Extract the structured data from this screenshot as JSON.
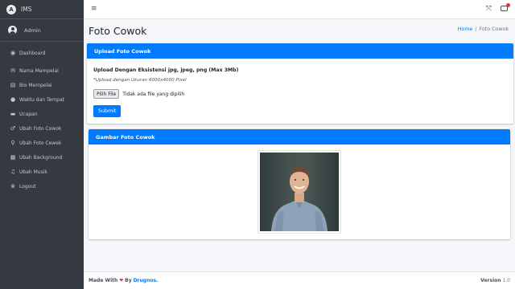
{
  "app": {
    "brand": "IMS",
    "brand_logo": "A",
    "user": "Admin"
  },
  "sidebar": {
    "items": [
      {
        "label": "Dashboard",
        "icon": "dashboard-icon",
        "glyph": "◉"
      },
      {
        "label": "Nama Mempelai",
        "icon": "envelope-icon",
        "glyph": "✉"
      },
      {
        "label": "Bio Mempelai",
        "icon": "id-card-icon",
        "glyph": "▤"
      },
      {
        "label": "Waktu dan Tempat",
        "icon": "map-pin-icon",
        "glyph": "●"
      },
      {
        "label": "Ucapan",
        "icon": "comment-icon",
        "glyph": "▬"
      },
      {
        "label": "Ubah Foto Cowok",
        "icon": "mars-icon",
        "glyph": "♂"
      },
      {
        "label": "Ubah Foto Cewek",
        "icon": "venus-icon",
        "glyph": "♀"
      },
      {
        "label": "Ubah Background",
        "icon": "image-icon",
        "glyph": "▦"
      },
      {
        "label": "Ubah Musik",
        "icon": "music-icon",
        "glyph": "♫"
      },
      {
        "label": "Logout",
        "icon": "logout-icon",
        "glyph": "⊗"
      }
    ]
  },
  "topbar": {
    "menu_glyph": "≡",
    "expand_glyph": "⤧"
  },
  "header": {
    "title": "Foto Cowok"
  },
  "breadcrumb": {
    "home": "Home",
    "separator": "/",
    "current": "Foto Cowok"
  },
  "upload_card": {
    "title": "Upload Foto Cowok",
    "label": "Upload Dengan Eksistensi jpg, jpeg, png (Max 3Mb)",
    "note": "*Upload dengan Ukuran 6000x4000 Pixel",
    "file_button": "Pilih File",
    "file_status": "Tidak ada file yang dipilih",
    "submit": "Submit"
  },
  "photo_card": {
    "title": "Gambar Foto Cowok"
  },
  "footer": {
    "made_with": "Made With",
    "heart": "❤",
    "by": "By",
    "author": "Drugnos.",
    "version_label": "Version",
    "version": "1.0"
  },
  "colors": {
    "primary": "#007bff",
    "sidebar": "#343a40",
    "danger": "#dc3545"
  }
}
